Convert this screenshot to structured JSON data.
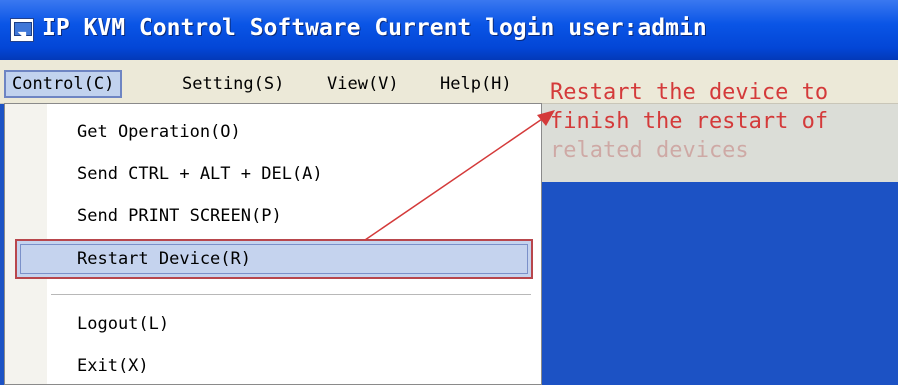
{
  "window": {
    "title": "IP KVM Control Software Current login user:admin"
  },
  "menubar": {
    "items": [
      {
        "label": "Control(C)",
        "active": true
      },
      {
        "label": "Setting(S)",
        "active": false
      },
      {
        "label": "View(V)",
        "active": false
      },
      {
        "label": "Help(H)",
        "active": false
      }
    ]
  },
  "control_menu": {
    "items": [
      {
        "label": "Get Operation(O)"
      },
      {
        "label": "Send CTRL + ALT + DEL(A)"
      },
      {
        "label": "Send PRINT SCREEN(P)"
      },
      {
        "label": "Restart Device(R)",
        "highlighted": true
      },
      {
        "label": "Logout(L)"
      },
      {
        "label": "Exit(X)"
      }
    ]
  },
  "annotation": {
    "line1": "Restart the device to",
    "line2": "finish the restart of",
    "line3": "related devices",
    "color": "#d43a3a"
  },
  "colors": {
    "titlebar": "#0a55e6",
    "menubar": "#ece9d8",
    "highlight_border": "#b8464c",
    "desktop": "#1c52c4"
  },
  "icons": {
    "app": "kvm-app-icon",
    "arrow": "annotation-arrow"
  }
}
